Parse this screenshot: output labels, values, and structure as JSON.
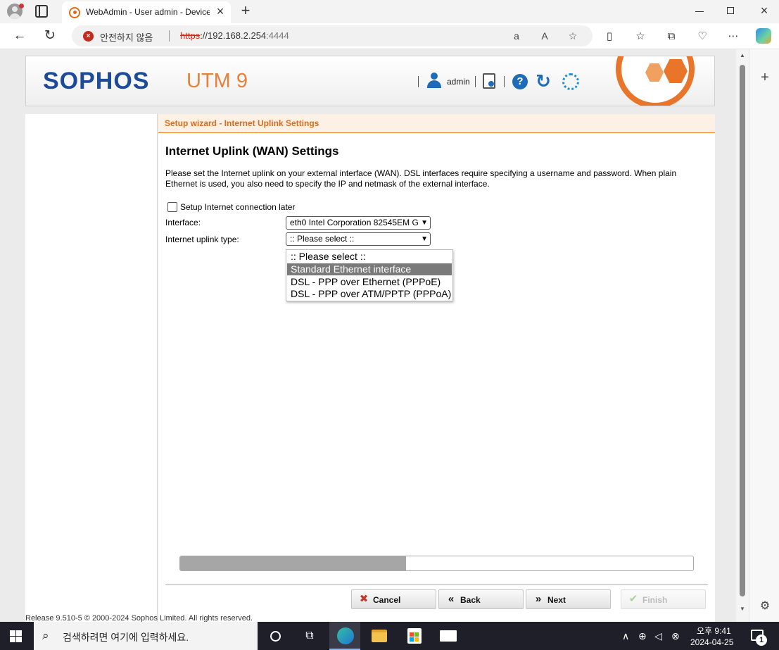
{
  "browser": {
    "tab_title": "WebAdmin - User admin - Device",
    "security_label": "안전하지 않음",
    "url_scheme": "https",
    "url_host": "://192.168.2.254",
    "url_port": ":4444",
    "icons": [
      "back-icon",
      "reload-icon",
      "read-aloud-icon",
      "favorite-icon",
      "split-screen-icon",
      "favorites-icon",
      "collections-icon",
      "browser-essentials-icon",
      "more-icon",
      "copilot-icon"
    ]
  },
  "header": {
    "brand": "SOPHOS",
    "product": "UTM 9",
    "user": "admin"
  },
  "wizard": {
    "bar_title": "Setup wizard - Internet Uplink Settings",
    "title": "Internet Uplink (WAN) Settings",
    "description": "Please set the Internet uplink on your external interface (WAN). DSL interfaces require specifying a username and password. When plain Ethernet is used, you also need to specify the IP and netmask of the external interface.",
    "later_label": "Setup Internet connection later",
    "interface_label": "Interface:",
    "interface_value": "eth0 Intel Corporation 82545EM G",
    "uplink_label": "Internet uplink type:",
    "uplink_value": ":: Please select ::",
    "dropdown_options": [
      ":: Please select ::",
      "Standard Ethernet interface",
      "DSL - PPP over Ethernet (PPPoE)",
      "DSL - PPP over ATM/PPTP (PPPoA)"
    ],
    "highlighted_option_index": 1,
    "progress_fraction": 0.44,
    "buttons": {
      "cancel": "Cancel",
      "back": "Back",
      "next": "Next",
      "finish": "Finish"
    }
  },
  "footer": {
    "text": "Release 9.510-5  © 2000-2024 Sophos Limited. All rights reserved."
  },
  "taskbar": {
    "search_placeholder": "검색하려면 여기에 입력하세요.",
    "time": "오후 9:41",
    "date": "2024-04-25",
    "notification_count": "1"
  },
  "colors": {
    "sophos_blue": "#1e4a9a",
    "utm_orange": "#e8823a",
    "wizard_orange": "#e06b1a",
    "cancel_red": "#c0392b",
    "finish_green": "#a7d39b"
  }
}
